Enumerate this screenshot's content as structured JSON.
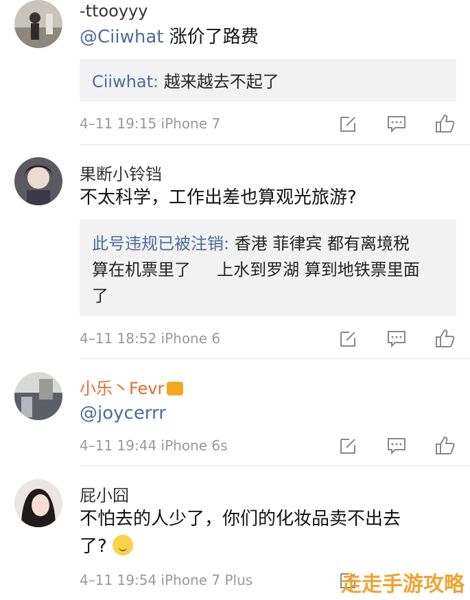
{
  "comments": [
    {
      "username": "-ttooyyy",
      "mention": "@Ciiwhat",
      "text": " 涨价了路费",
      "quote_name": "Ciiwhat:",
      "quote_text": " 越来越去不起了",
      "meta": "4–11 19:15 iPhone 7"
    },
    {
      "username": "果断小铃铛",
      "text": "不太科学，工作出差也算观光旅游?",
      "quote_name": "此号违规已被注销:",
      "quote_text_1": " 香港 菲律宾 都有离境税",
      "quote_text_2": "算在机票里了     上水到罗湖 算到地铁票里面",
      "quote_text_3": "了",
      "meta": "4–11 18:52 iPhone 6"
    },
    {
      "username": "小乐丶Fevr",
      "mention": "@joycerrr",
      "meta": "4–11 19:44 iPhone 6s"
    },
    {
      "username": "屁小囧",
      "text_1": "不怕去的人少了，你们的化妆品卖不出去",
      "text_2": "了?",
      "meta": "4–11 19:54 iPhone 7 Plus"
    }
  ],
  "icons": [
    "edit-icon",
    "comment-icon",
    "like-icon"
  ],
  "colors": {
    "mention": "#4d6c99",
    "vip_name": "#e8692c",
    "quote_bg": "#f2f2f2"
  },
  "watermark": "走走手游攻略"
}
